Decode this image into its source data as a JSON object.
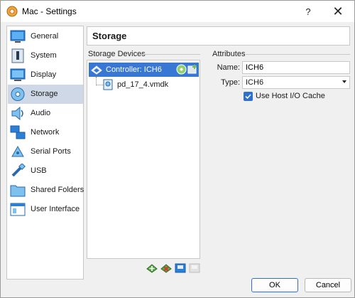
{
  "window": {
    "title": "Mac - Settings"
  },
  "titlebar": {
    "help_label": "?",
    "close_label": "✕"
  },
  "sidebar": {
    "items": [
      {
        "label": "General",
        "icon": "general-icon"
      },
      {
        "label": "System",
        "icon": "system-icon"
      },
      {
        "label": "Display",
        "icon": "display-icon"
      },
      {
        "label": "Storage",
        "icon": "storage-icon",
        "selected": true
      },
      {
        "label": "Audio",
        "icon": "audio-icon"
      },
      {
        "label": "Network",
        "icon": "network-icon"
      },
      {
        "label": "Serial Ports",
        "icon": "serial-ports-icon"
      },
      {
        "label": "USB",
        "icon": "usb-icon"
      },
      {
        "label": "Shared Folders",
        "icon": "shared-folders-icon"
      },
      {
        "label": "User Interface",
        "icon": "user-interface-icon"
      }
    ]
  },
  "page": {
    "title": "Storage"
  },
  "storage_devices": {
    "section_label": "Storage Devices",
    "controller": {
      "label": "Controller: ICH6"
    },
    "disk": {
      "label": "pd_17_4.vmdk"
    }
  },
  "attributes": {
    "section_label": "Attributes",
    "name_label": "Name:",
    "name_value": "ICH6",
    "type_label": "Type:",
    "type_value": "ICH6",
    "host_io_cache_label": "Use Host I/O Cache",
    "host_io_cache_checked": true
  },
  "buttons": {
    "ok": "OK",
    "cancel": "Cancel"
  },
  "colors": {
    "selection": "#3878d4",
    "accent": "#2f6fd0",
    "sidebar_selected": "#cfd8e6"
  }
}
